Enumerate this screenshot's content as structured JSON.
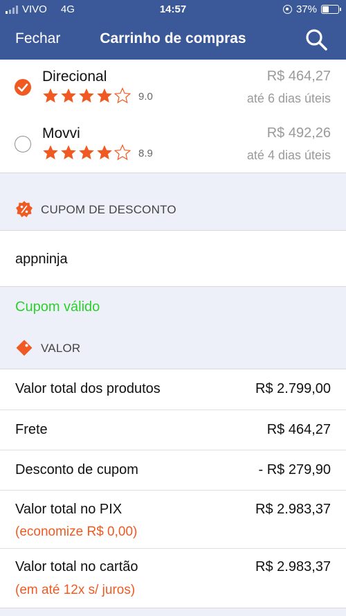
{
  "status_bar": {
    "carrier": "VIVO",
    "network": "4G",
    "time": "14:57",
    "battery": "37%"
  },
  "navbar": {
    "close_label": "Fechar",
    "title": "Carrinho de compras",
    "search_icon": "search-icon"
  },
  "sellers": [
    {
      "name": "Direcional",
      "rating": "9.0",
      "stars": 4.5,
      "price": "R$ 464,27",
      "eta": "até 6 dias úteis",
      "selected": true
    },
    {
      "name": "Movvi",
      "rating": "8.9",
      "stars": 4.5,
      "price": "R$ 492,26",
      "eta": "até 4 dias úteis",
      "selected": false
    }
  ],
  "coupon": {
    "section_title": "CUPOM DE DESCONTO",
    "code": "appninja",
    "status": "Cupom válido"
  },
  "value": {
    "section_title": "VALOR",
    "products_label": "Valor total dos produtos",
    "products_value": "R$ 2.799,00",
    "shipping_label": "Frete",
    "shipping_value": "R$ 464,27",
    "discount_label": "Desconto de cupom",
    "discount_value": "- R$ 279,90",
    "pix_label": "Valor total no PIX",
    "pix_value": "R$ 2.983,37",
    "pix_note": "(economize R$ 0,00)",
    "card_label": "Valor total no cartão",
    "card_value": "R$ 2.983,37",
    "card_note": "(em até 12x s/ juros)"
  },
  "colors": {
    "navbar": "#3b5998",
    "accent": "#f05a22",
    "valid": "#2bd12b",
    "background": "#eef0f9"
  }
}
